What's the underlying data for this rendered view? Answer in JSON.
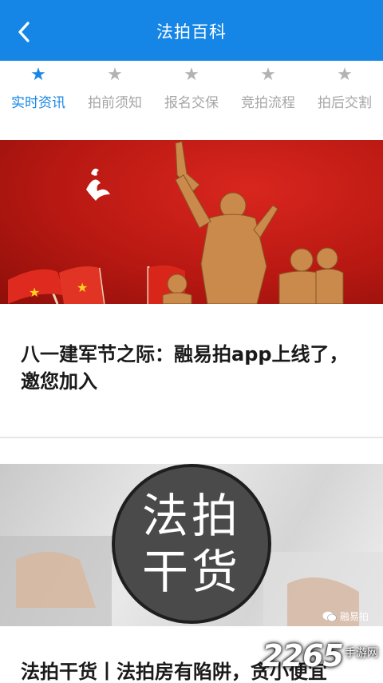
{
  "header": {
    "title": "法拍百科",
    "back_icon": "chevron-left-icon"
  },
  "tabs": [
    {
      "label": "实时资讯",
      "icon": "star-icon",
      "active": true
    },
    {
      "label": "拍前须知",
      "icon": "star-icon",
      "active": false
    },
    {
      "label": "报名交保",
      "icon": "star-icon",
      "active": false
    },
    {
      "label": "竞拍流程",
      "icon": "star-icon",
      "active": false
    },
    {
      "label": "拍后交割",
      "icon": "star-icon",
      "active": false
    }
  ],
  "articles": [
    {
      "title": "八一建军节之际：融易拍app上线了，邀您加入"
    },
    {
      "title": "法拍干货丨法拍房有陷阱，贪小便宜",
      "badge_line1": "法拍",
      "badge_line2": "干货",
      "source_tag": "融易拍"
    }
  ],
  "watermark": {
    "number": "2265",
    "text": "手游网"
  },
  "colors": {
    "accent": "#1686e6",
    "inactive": "#a6a6a6",
    "banner_red": "#c41a14"
  }
}
